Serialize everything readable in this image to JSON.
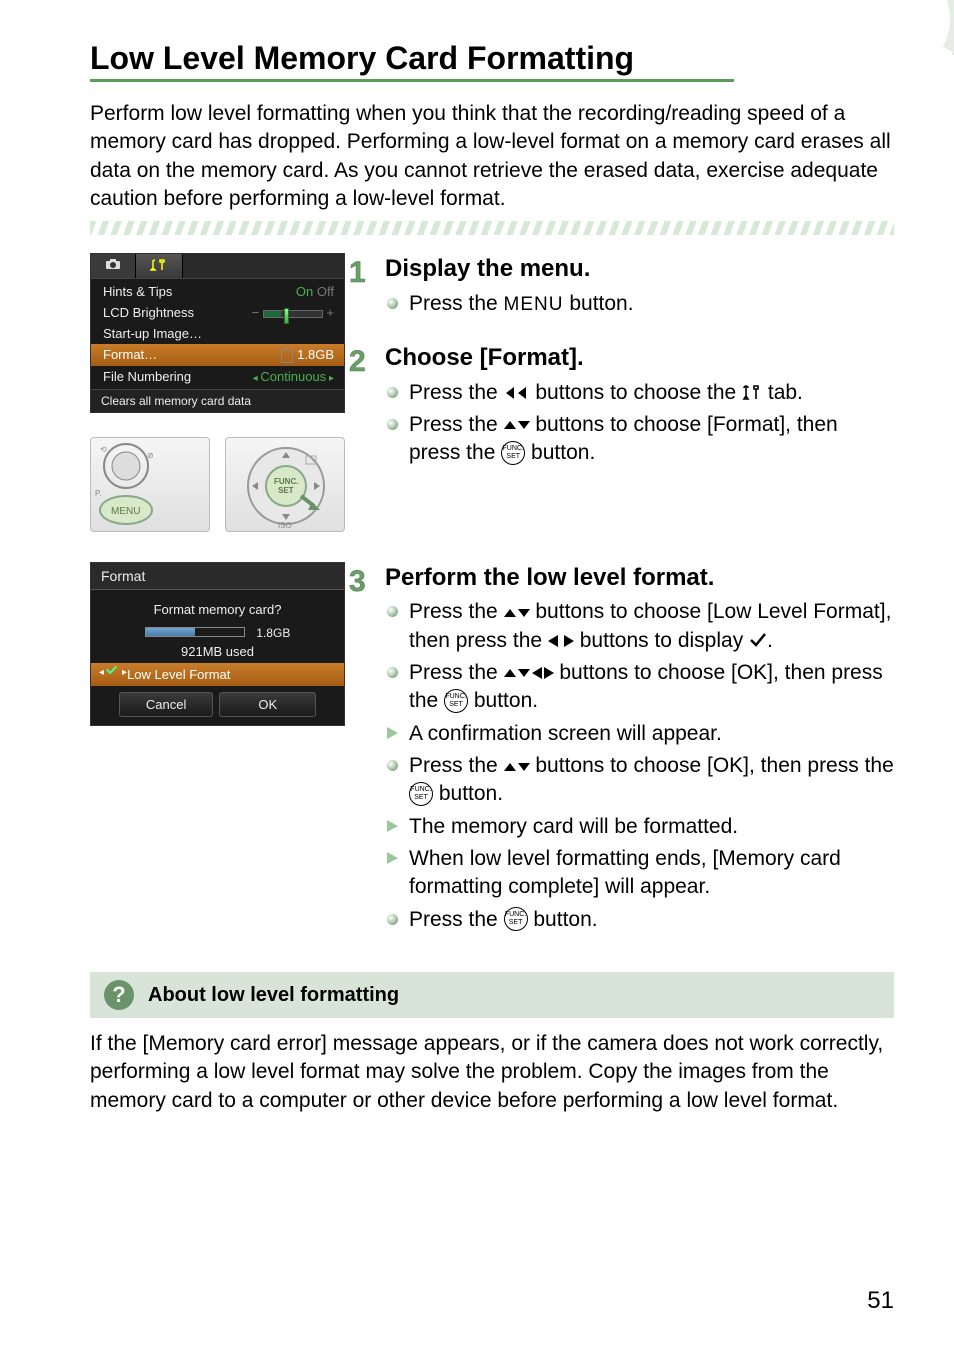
{
  "page": {
    "title": "Low Level Memory Card Formatting",
    "intro": "Perform low level formatting when you think that the recording/reading speed of a memory card has dropped. Performing a low-level format on a memory card erases all data on the memory card. As you cannot retrieve the erased data, exercise adequate caution before performing a low-level format.",
    "number": "51"
  },
  "menuShot": {
    "rows": {
      "hints": {
        "label": "Hints & Tips",
        "value": "On",
        "dim": "Off"
      },
      "lcd": {
        "label": "LCD Brightness"
      },
      "startup": {
        "label": "Start-up Image…"
      },
      "format": {
        "label": "Format…",
        "value": "1.8GB"
      },
      "filenum": {
        "label": "File Numbering",
        "value": "Continuous"
      }
    },
    "footer": "Clears all memory card data"
  },
  "formatShot": {
    "title": "Format",
    "question": "Format memory card?",
    "size": "1.8GB",
    "used": "921MB used",
    "option": "Low Level Format",
    "cancel": "Cancel",
    "ok": "OK"
  },
  "steps": {
    "s1": {
      "num": "1",
      "head": "Display the menu.",
      "li1a": "Press the ",
      "menu": "MENU",
      "li1b": " button."
    },
    "s2": {
      "num": "2",
      "head": "Choose [Format].",
      "li1a": "Press the ",
      "li1b": " buttons to choose the ",
      "li1c": " tab.",
      "li2a": "Press the ",
      "li2b": " buttons to choose [Format], then press the ",
      "li2c": " button."
    },
    "s3": {
      "num": "3",
      "head": "Perform the low level format.",
      "li1a": "Press the ",
      "li1b": " buttons to choose [Low Level Format], then press the ",
      "li1c": " buttons to display ",
      "li1d": ".",
      "li2a": "Press the ",
      "li2b": " buttons to choose [OK], then press the ",
      "li2c": " button.",
      "li3": "A confirmation screen will appear.",
      "li4a": "Press the ",
      "li4b": " buttons to choose [OK], then press the ",
      "li4c": " button.",
      "li5": "The memory card will be formatted.",
      "li6": "When low level formatting ends, [Memory card formatting complete] will appear.",
      "li7a": "Press the ",
      "li7b": " button."
    }
  },
  "about": {
    "heading": "About low level formatting",
    "body": "If the [Memory card error] message appears, or if the camera does not work correctly, performing a low level format may solve the problem. Copy the images from the memory card to a computer or other device before performing a low level format."
  }
}
